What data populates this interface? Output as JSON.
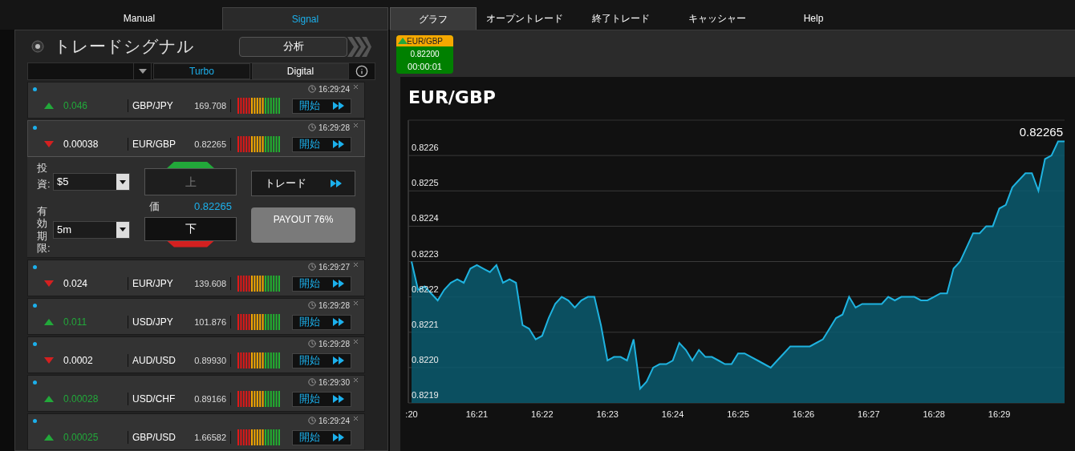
{
  "nav_left": [
    {
      "label": "Manual",
      "selected": false
    },
    {
      "label": "Signal",
      "selected": true
    }
  ],
  "nav_right": [
    {
      "label": "グラフ",
      "selected": true
    },
    {
      "label": "オープントレード",
      "selected": false
    },
    {
      "label": "終了トレード",
      "selected": false
    },
    {
      "label": "キャッシャー",
      "selected": false
    },
    {
      "label": "Help",
      "selected": false
    }
  ],
  "signal_panel": {
    "title": "トレードシグナル",
    "analysis_button": "分析",
    "filters": {
      "tabs": [
        {
          "label": "Turbo",
          "selected": true
        },
        {
          "label": "Digital",
          "selected": false
        }
      ]
    },
    "rows": [
      {
        "up": true,
        "change": "0.046",
        "pair": "GBP/JPY",
        "price": "169.708",
        "time": "16:29:24",
        "button": "開始",
        "expanded": false
      },
      {
        "up": false,
        "change": "0.00038",
        "pair": "EUR/GBP",
        "price": "0.82265",
        "time": "16:29:28",
        "button": "開始",
        "expanded": true,
        "trade_form": {
          "investment_label": "投資:",
          "investment": "$5",
          "expiry_label": "有効期限:",
          "expiry": "5m",
          "up_button": {
            "label": "上",
            "selected": false
          },
          "price_label": "価",
          "price": "0.82265",
          "down_button": {
            "label": "下",
            "selected": true
          },
          "trade_button": "トレード",
          "payout": "PAYOUT 76%"
        }
      },
      {
        "up": false,
        "change": "0.024",
        "pair": "EUR/JPY",
        "price": "139.608",
        "time": "16:29:27",
        "button": "開始",
        "expanded": false
      },
      {
        "up": true,
        "change": "0.011",
        "pair": "USD/JPY",
        "price": "101.876",
        "time": "16:29:28",
        "button": "開始",
        "expanded": false
      },
      {
        "up": false,
        "change": "0.0002",
        "pair": "AUD/USD",
        "price": "0.89930",
        "time": "16:29:28",
        "button": "開始",
        "expanded": false
      },
      {
        "up": true,
        "change": "0.00028",
        "pair": "USD/CHF",
        "price": "0.89166",
        "time": "16:29:30",
        "button": "開始",
        "expanded": false
      },
      {
        "up": true,
        "change": "0.00025",
        "pair": "GBP/USD",
        "price": "1.66582",
        "time": "16:29:24",
        "button": "開始",
        "expanded": false
      }
    ]
  },
  "ticket": {
    "up": true,
    "pair": "EUR/GBP",
    "price": "0.82200",
    "timer": "00:00:01"
  },
  "chart": {
    "title": "EUR/GBP",
    "chart_data": {
      "type": "area",
      "grid": true,
      "ylim": [
        0.8219,
        0.8227
      ],
      "categories": [
        ":20",
        null,
        null,
        null,
        null,
        null,
        null,
        null,
        null,
        null,
        "16:21",
        null,
        null,
        null,
        null,
        null,
        null,
        null,
        null,
        null,
        "16:22",
        null,
        null,
        null,
        null,
        null,
        null,
        null,
        null,
        null,
        "16:23",
        null,
        null,
        null,
        null,
        null,
        null,
        null,
        null,
        null,
        "16:24",
        null,
        null,
        null,
        null,
        null,
        null,
        null,
        null,
        null,
        "16:25",
        null,
        null,
        null,
        null,
        null,
        null,
        null,
        null,
        null,
        "16:26",
        null,
        null,
        null,
        null,
        null,
        null,
        null,
        null,
        null,
        "16:27",
        null,
        null,
        null,
        null,
        null,
        null,
        null,
        null,
        null,
        "16:28",
        null,
        null,
        null,
        null,
        null,
        null,
        null,
        null,
        null,
        "16:29",
        null,
        null,
        null,
        null,
        null,
        null,
        null,
        null,
        null,
        null
      ],
      "yticks": [
        {
          "value": 0.8219,
          "label": "0.8219"
        },
        {
          "value": 0.822,
          "label": "0.8220"
        },
        {
          "value": 0.8221,
          "label": "0.8221"
        },
        {
          "value": 0.8222,
          "label": "0.8222"
        },
        {
          "value": 0.8223,
          "label": "0.8223"
        },
        {
          "value": 0.8224,
          "label": "0.8224"
        },
        {
          "value": 0.8225,
          "label": "0.8225"
        },
        {
          "value": 0.8226,
          "label": "0.8226"
        }
      ],
      "series": [
        {
          "color": "#1fb3e0",
          "values": [
            0.8223,
            0.82222,
            0.82223,
            0.82221,
            0.82219,
            0.82222,
            0.82224,
            0.82225,
            0.82224,
            0.82228,
            0.82229,
            0.82228,
            0.82227,
            0.82229,
            0.82224,
            0.82225,
            0.82224,
            0.82212,
            0.82211,
            0.82208,
            0.82209,
            0.82214,
            0.82218,
            0.8222,
            0.82219,
            0.82217,
            0.82219,
            0.8222,
            0.8222,
            0.82212,
            0.82202,
            0.82203,
            0.82203,
            0.82202,
            0.82208,
            0.82194,
            0.82196,
            0.822,
            0.82201,
            0.82201,
            0.82202,
            0.82207,
            0.82205,
            0.82202,
            0.82205,
            0.82203,
            0.82203,
            0.82202,
            0.82201,
            0.82201,
            0.82204,
            0.82204,
            0.82203,
            0.82202,
            0.82201,
            0.822,
            0.82202,
            0.82204,
            0.82206,
            0.82206,
            0.82206,
            0.82206,
            0.82207,
            0.82208,
            0.82211,
            0.82214,
            0.82215,
            0.8222,
            0.82217,
            0.82218,
            0.82218,
            0.82218,
            0.82218,
            0.8222,
            0.82219,
            0.8222,
            0.8222,
            0.8222,
            0.82219,
            0.82219,
            0.8222,
            0.82221,
            0.82221,
            0.82228,
            0.8223,
            0.82234,
            0.82238,
            0.82238,
            0.8224,
            0.8224,
            0.82245,
            0.82246,
            0.82251,
            0.82253,
            0.82255,
            0.82255,
            0.8225,
            0.82259,
            0.8226,
            0.82264,
            0.82264
          ]
        }
      ],
      "annotations": [
        "0.82265"
      ]
    }
  }
}
